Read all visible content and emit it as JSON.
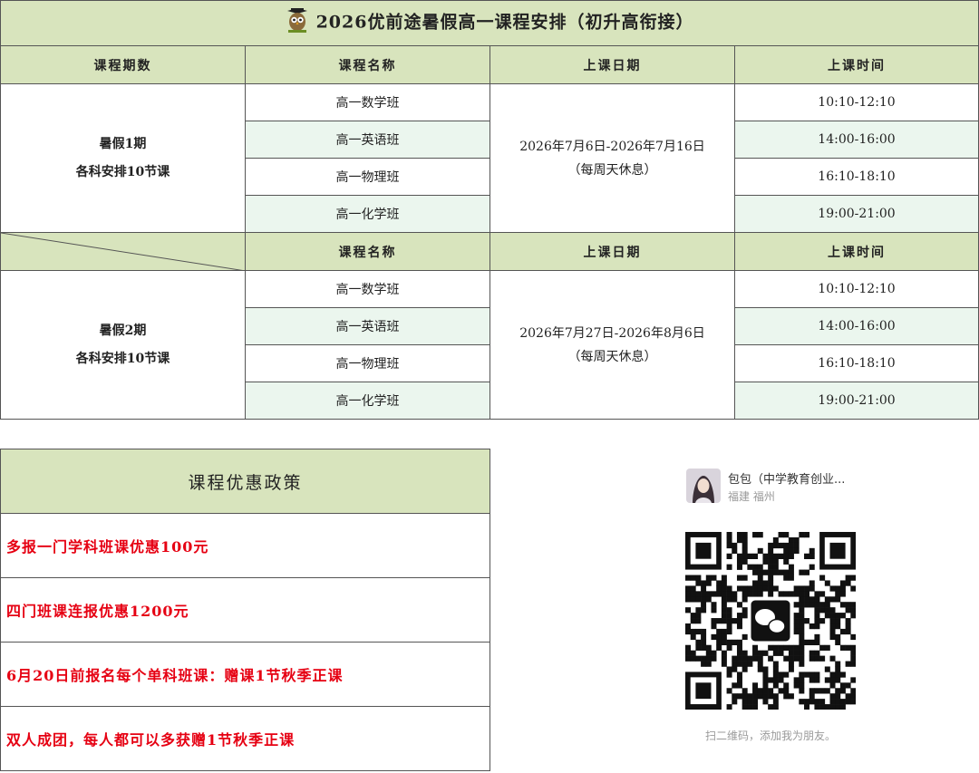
{
  "schedule": {
    "title": "2026优前途暑假高一课程安排（初升高衔接）",
    "headers": {
      "term": "课程期数",
      "course": "课程名称",
      "dates": "上课日期",
      "time": "上课时间"
    },
    "term1": {
      "name": "暑假1期",
      "note": "各科安排10节课",
      "dates": "2026年7月6日-2026年7月16日",
      "rest": "（每周天休息）",
      "rows": [
        {
          "course": "高一数学班",
          "time": "10:10-12:10"
        },
        {
          "course": "高一英语班",
          "time": "14:00-16:00"
        },
        {
          "course": "高一物理班",
          "time": "16:10-18:10"
        },
        {
          "course": "高一化学班",
          "time": "19:00-21:00"
        }
      ]
    },
    "term2": {
      "name": "暑假2期",
      "note": "各科安排10节课",
      "dates": "2026年7月27日-2026年8月6日",
      "rest": "（每周天休息）",
      "rows": [
        {
          "course": "高一数学班",
          "time": "10:10-12:10"
        },
        {
          "course": "高一英语班",
          "time": "14:00-16:00"
        },
        {
          "course": "高一物理班",
          "time": "16:10-18:10"
        },
        {
          "course": "高一化学班",
          "time": "19:00-21:00"
        }
      ]
    }
  },
  "promo": {
    "title": "课程优惠政策",
    "items": [
      "多报一门学科班课优惠100元",
      "四门班课连报优惠1200元",
      "6月20日前报名每个单科班课：赠课1节秋季正课",
      "双人成团，每人都可以多获赠1节秋季正课"
    ]
  },
  "contact": {
    "name": "包包（中学教育创业...",
    "location": "福建 福州",
    "caption": "扫二维码，添加我为朋友。"
  },
  "colors": {
    "header_bg": "#d8e4bd",
    "row_tint": "#ebf6ee",
    "promo_text": "#e60012"
  },
  "icons": [
    "owl-mascot-icon",
    "wechat-icon"
  ]
}
